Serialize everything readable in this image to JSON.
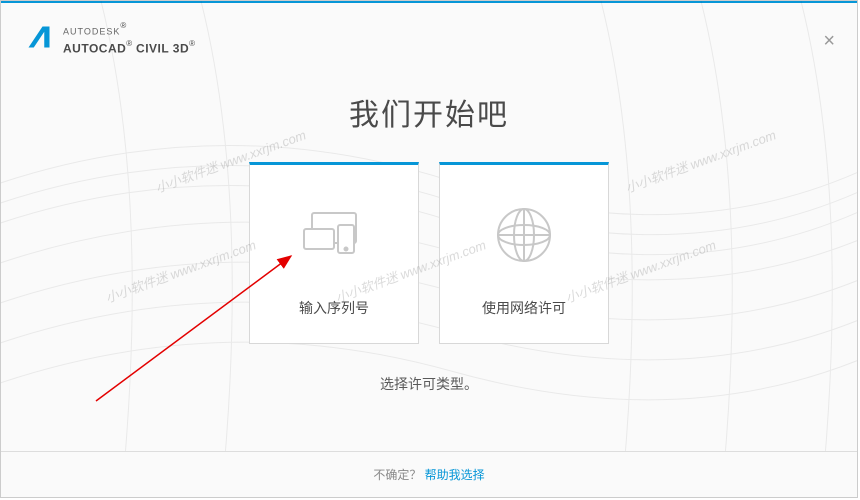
{
  "header": {
    "brand_top": "AUTODESK",
    "brand_bottom_1": "AUTOCAD",
    "brand_bottom_2": " CIVIL 3D",
    "registered": "®"
  },
  "main": {
    "title": "我们开始吧",
    "subtitle": "选择许可类型。"
  },
  "cards": {
    "serial": {
      "label": "输入序列号"
    },
    "network": {
      "label": "使用网络许可"
    }
  },
  "footer": {
    "prompt": "不确定？",
    "link_text": "帮助我选择"
  },
  "watermark_text": "小小软件迷 www.xxrjm.com"
}
